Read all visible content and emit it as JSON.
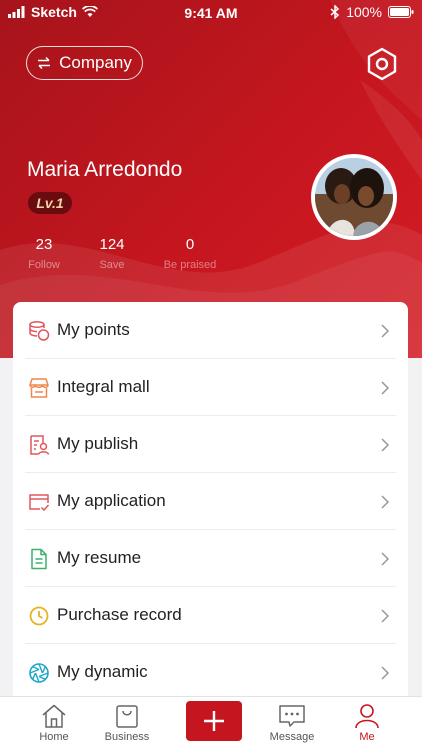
{
  "status_bar": {
    "carrier": "Sketch",
    "time": "9:41 AM",
    "battery": "100%"
  },
  "header": {
    "company_label": "Company",
    "user_name": "Maria Arredondo",
    "level": "Lv.1",
    "stats": [
      {
        "value": "23",
        "label": "Follow"
      },
      {
        "value": "124",
        "label": "Save"
      },
      {
        "value": "0",
        "label": "Be praised"
      }
    ]
  },
  "menu": {
    "items": [
      {
        "label": "My points",
        "icon": "points-coins-icon",
        "color": "#e0565c"
      },
      {
        "label": "Integral mall",
        "icon": "store-icon",
        "color": "#f0874a"
      },
      {
        "label": "My publish",
        "icon": "publish-icon",
        "color": "#e0565c"
      },
      {
        "label": "My application",
        "icon": "application-icon",
        "color": "#e0565c"
      },
      {
        "label": "My resume",
        "icon": "resume-document-icon",
        "color": "#3bb26a"
      },
      {
        "label": "Purchase record",
        "icon": "clock-icon",
        "color": "#e8b21e"
      },
      {
        "label": "My dynamic",
        "icon": "aperture-icon",
        "color": "#1fa6c8"
      }
    ]
  },
  "tabbar": {
    "items": [
      {
        "label": "Home",
        "icon": "home-icon"
      },
      {
        "label": "Business",
        "icon": "bag-icon"
      },
      {
        "label": "Message",
        "icon": "message-icon"
      },
      {
        "label": "Me",
        "icon": "person-icon"
      }
    ]
  },
  "colors": {
    "brand": "#c5161f",
    "level_badge": "#6a0b0f"
  }
}
